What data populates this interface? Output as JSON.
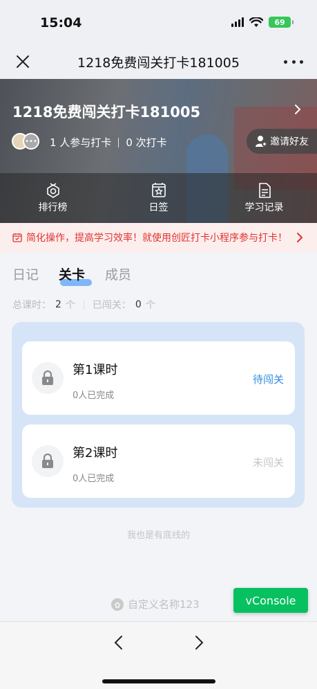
{
  "status_bar": {
    "time": "15:04",
    "battery": "69"
  },
  "nav": {
    "title": "1218免费闯关打卡181005",
    "close_icon": "close-icon",
    "more_icon": "more-icon"
  },
  "hero": {
    "title": "1218免费闯关打卡181005",
    "participants": "1 人参与打卡",
    "checkins": "0 次打卡",
    "invite_label": "邀请好友",
    "actions": [
      {
        "label": "排行榜",
        "icon": "ranking-icon"
      },
      {
        "label": "日签",
        "icon": "daily-sign-icon"
      },
      {
        "label": "学习记录",
        "icon": "study-record-icon"
      }
    ]
  },
  "promo": {
    "text": "简化操作，提高学习效率！就使用创匠打卡小程序参与打卡！"
  },
  "tabs": [
    {
      "label": "日记",
      "active": false
    },
    {
      "label": "关卡",
      "active": true
    },
    {
      "label": "成员",
      "active": false
    }
  ],
  "summary": {
    "total_label": "总课时：",
    "total_value": "2",
    "total_unit": "个",
    "passed_label": "已闯关：",
    "passed_value": "0",
    "passed_unit": "个"
  },
  "lessons": [
    {
      "title": "第1课时",
      "completed": "0人已完成",
      "status": "待闯关"
    },
    {
      "title": "第2课时",
      "completed": "0人已完成",
      "status": "未闯关"
    }
  ],
  "footer": {
    "bottom_line": "我也是有底线的",
    "brand": "自定义名称123",
    "vconsole": "vConsole"
  },
  "colors": {
    "accent_blue": "#2e8de0",
    "promo_red": "#e0332e",
    "vconsole_green": "#07c160"
  }
}
